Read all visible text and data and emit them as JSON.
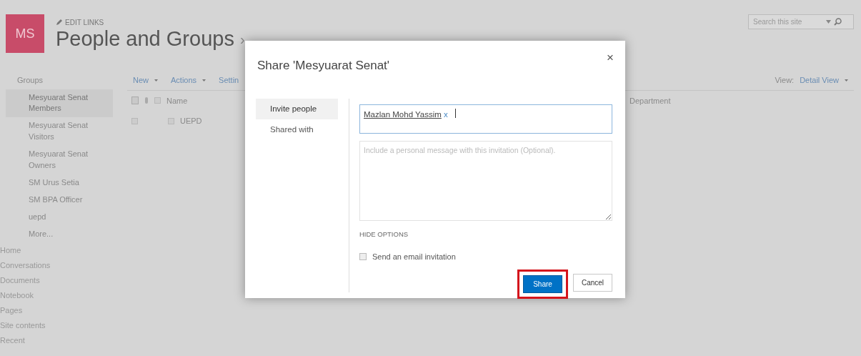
{
  "site": {
    "logo": "MS",
    "edit_links": "EDIT LINKS",
    "title": "People and Groups",
    "separator": "›"
  },
  "search": {
    "placeholder": "Search this site"
  },
  "groups_nav": {
    "heading": "Groups",
    "items": [
      {
        "label": "Mesyuarat Senat Members",
        "selected": true
      },
      {
        "label": "Mesyuarat Senat Visitors",
        "selected": false
      },
      {
        "label": "Mesyuarat Senat Owners",
        "selected": false
      },
      {
        "label": "SM Urus Setia",
        "selected": false
      },
      {
        "label": "SM BPA Officer",
        "selected": false
      },
      {
        "label": "uepd",
        "selected": false
      },
      {
        "label": "More...",
        "selected": false
      }
    ]
  },
  "quick_launch": [
    "Home",
    "Conversations",
    "Documents",
    "Notebook",
    "Pages",
    "Site contents",
    "Recent"
  ],
  "toolbar": [
    {
      "label": "New",
      "dropdown": true
    },
    {
      "label": "Actions",
      "dropdown": true
    },
    {
      "label": "Settin",
      "dropdown": false
    }
  ],
  "view": {
    "label": "View:",
    "value": "Detail View"
  },
  "table": {
    "columns": [
      "Name",
      "Department"
    ],
    "header_checked": false,
    "rows": [
      {
        "name": "UEPD",
        "checked": false,
        "item_checked": false
      }
    ]
  },
  "dialog": {
    "title": "Share 'Mesyuarat Senat'",
    "close": "×",
    "tabs": [
      {
        "label": "Invite people",
        "selected": true
      },
      {
        "label": "Shared with",
        "selected": false
      }
    ],
    "recipients": [
      {
        "name": "Mazlan Mohd Yassim",
        "remove": "x"
      }
    ],
    "message_placeholder": "Include a personal message with this invitation (Optional).",
    "options_toggle": "HIDE OPTIONS",
    "email_invitation": {
      "label": "Send an email invitation",
      "checked": false
    },
    "buttons": [
      {
        "label": "Share",
        "kind": "primary",
        "highlighted": true
      },
      {
        "label": "Cancel",
        "kind": "default",
        "highlighted": false
      }
    ]
  }
}
